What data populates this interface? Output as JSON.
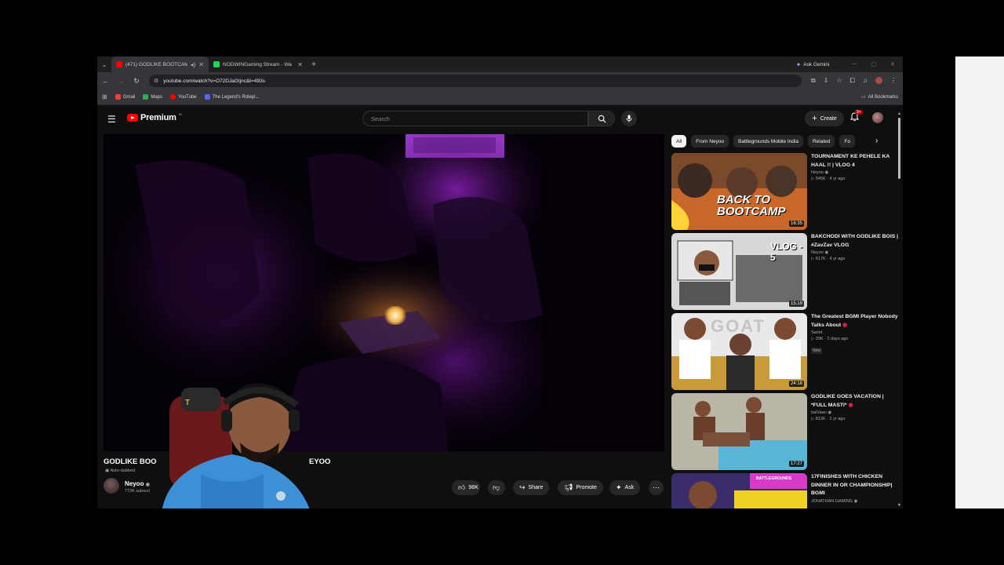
{
  "browser": {
    "tabs": [
      {
        "title": "(471) GODLIKE BOOTCAMP",
        "active": true,
        "favicon_color": "#ff0000"
      },
      {
        "title": "NODWINGaming Stream - Wa",
        "active": false,
        "favicon_color": "#1fd655"
      }
    ],
    "ask_gemini": "Ask Gemini",
    "url": "youtube.com/watch?v=O72DJaGtjnc&t=493s",
    "bookmarks": [
      {
        "label": "Gmail",
        "color": "#ea4335"
      },
      {
        "label": "Maps",
        "color": "#34a853"
      },
      {
        "label": "YouTube",
        "color": "#ff0000"
      },
      {
        "label": "The Legend's Rolepl...",
        "color": "#5865f2"
      }
    ],
    "all_bookmarks": "All Bookmarks"
  },
  "youtube": {
    "logo_text": "Premium",
    "logo_superscript": "IN",
    "search_placeholder": "Search",
    "create_label": "Create",
    "notification_badge": "9+"
  },
  "video": {
    "title_part1": "GODLIKE BOO",
    "title_part2": "EYOO",
    "auto_dubbed": "Auto-dubbed",
    "channel": "Neyoo",
    "subscribers": "772K subscri",
    "likes": "98K",
    "share_label": "Share",
    "promote_label": "Promote",
    "ask_label": "Ask"
  },
  "chips": [
    "All",
    "From Neyoo",
    "Battlegrounds Mobile India",
    "Related",
    "Fo"
  ],
  "recommendations": [
    {
      "title": "TOURNAMENT KE PEHELE KA HAAL !! | VLOG 4",
      "channel": "Neyoo",
      "views": "545K",
      "age": "4 yr ago",
      "duration": "16:35",
      "thumb_text": "BACK TO BOOTCAMP",
      "new": ""
    },
    {
      "title": "BAKCHODI WITH GODLIKE BOIS | #ZavZav VLOG",
      "channel": "Neyoo",
      "views": "517K",
      "age": "4 yr ago",
      "duration": "15:19",
      "thumb_text": "VLOG - 5",
      "new": ""
    },
    {
      "title": "The Greatest BGMI Player Nobody Talks About",
      "channel": "Sariot",
      "views": "39K",
      "age": "2 days ago",
      "duration": "24:18",
      "thumb_text": "GOAT",
      "new": "New"
    },
    {
      "title": "GODLIKE GOES VACATION | *FULL MASTI*",
      "channel": "halVaan",
      "views": "813K",
      "age": "2 yr ago",
      "duration": "17:27",
      "thumb_text": "",
      "new": ""
    },
    {
      "title": "17FINISHES WITH CHICKEN DINNER IN OR CHAMPIONSHIP| BGMI",
      "channel": "JONATHAN GAMING",
      "views": "",
      "age": "",
      "duration": "",
      "thumb_text": "BATTLEGROUNDS",
      "new": ""
    }
  ]
}
